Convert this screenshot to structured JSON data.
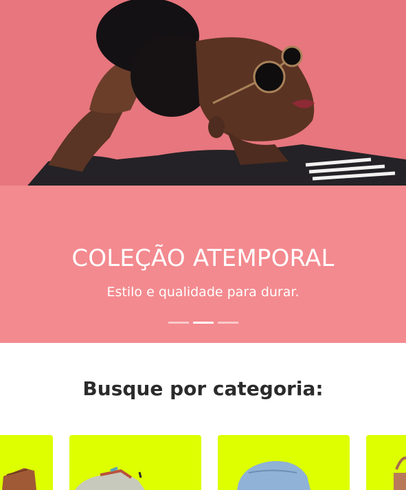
{
  "colors": {
    "hero_pink": "#F38A8F",
    "hero_photo_bg": "#E97A82",
    "category_card_bg": "#DDFF00",
    "heading_text": "#2B2B2B"
  },
  "hero": {
    "title": "COLEÇÃO ATEMPORAL",
    "subtitle": "Estilo e qualidade para durar.",
    "indicators": {
      "count": 3,
      "active_index": 1
    }
  },
  "categories": {
    "heading": "Busque por categoria:",
    "cards": [
      {
        "icon": "boot-icon"
      },
      {
        "icon": "sneaker-icon"
      },
      {
        "icon": "denim-icon"
      },
      {
        "icon": "bag-icon"
      }
    ]
  }
}
